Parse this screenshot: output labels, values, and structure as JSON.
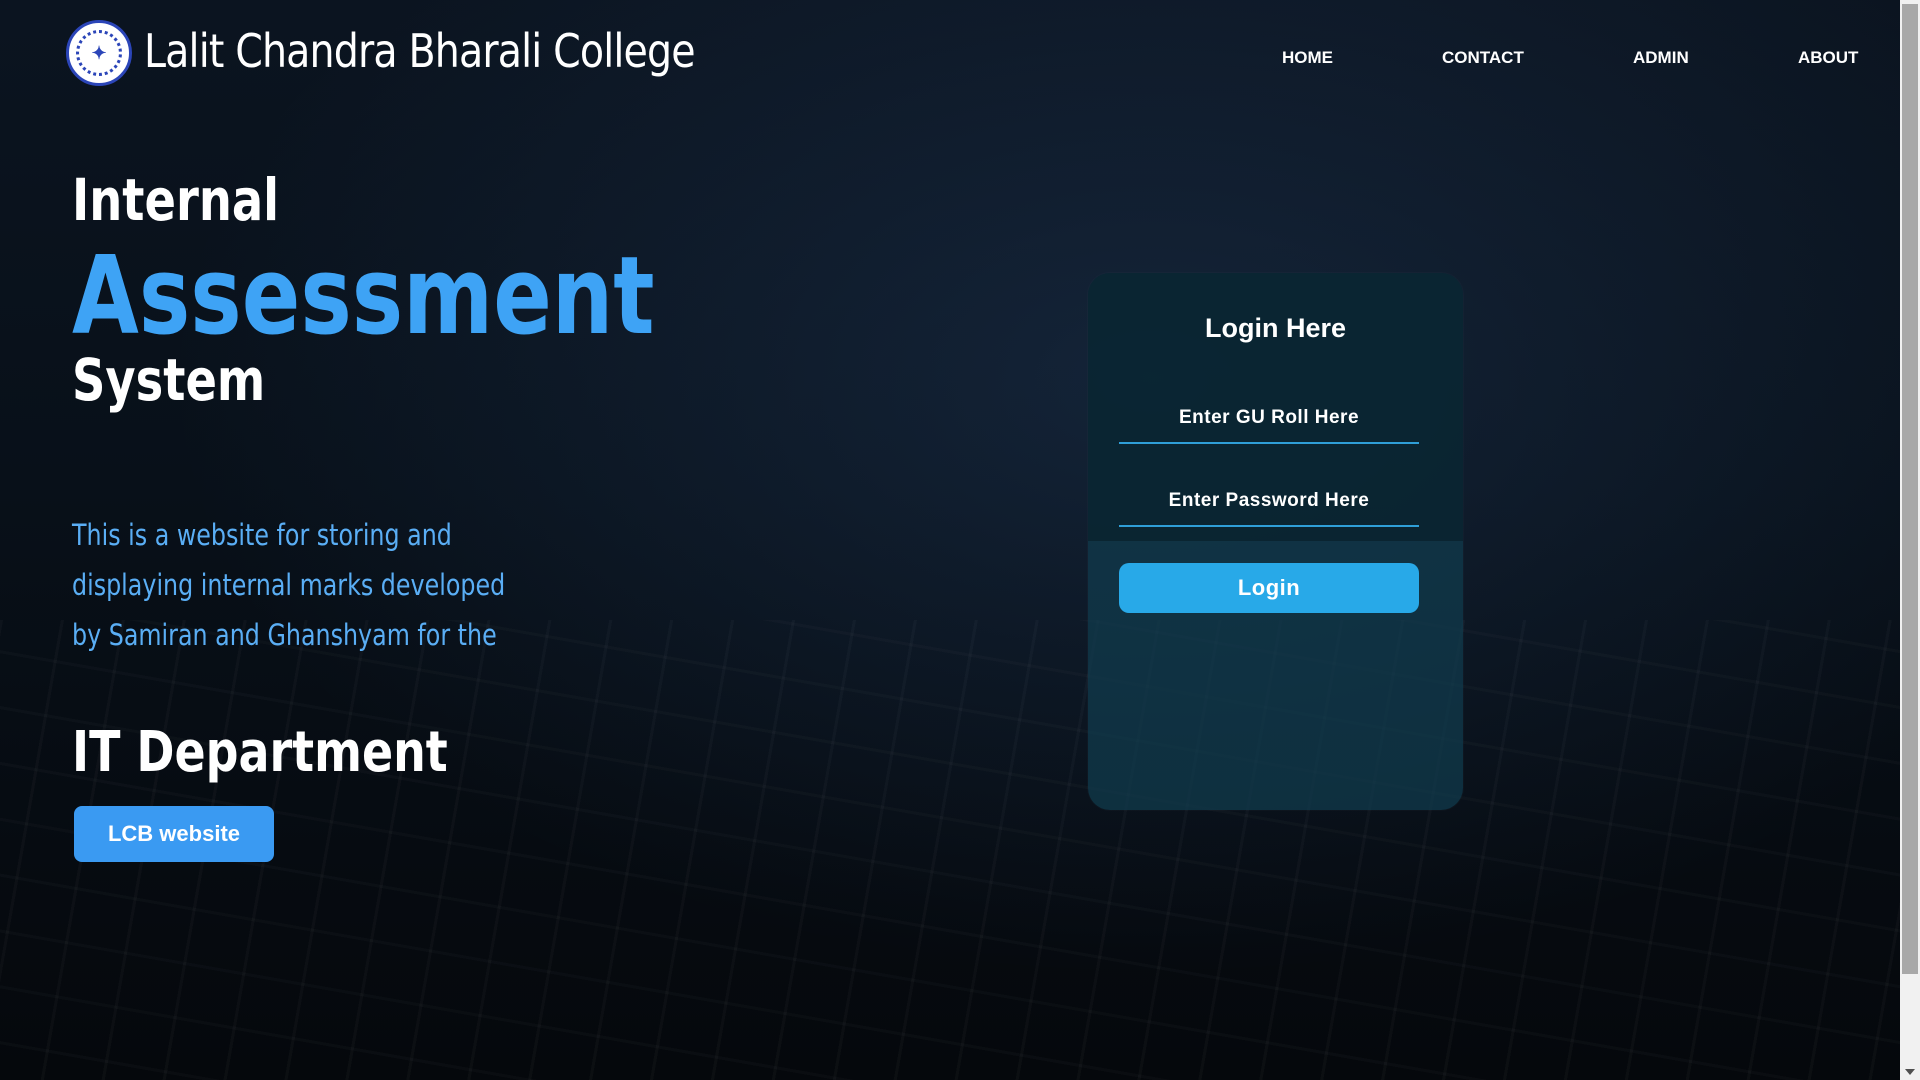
{
  "header": {
    "college_name": "Lalit Chandra Bharali College",
    "logo_icon": "college-seal-icon",
    "nav": {
      "home": "HOME",
      "contact": "CONTACT",
      "admin": "ADMIN",
      "about": "ABOUT"
    }
  },
  "hero": {
    "line1": "Internal",
    "line2": "Assessment",
    "line3": "System",
    "description": "This is a website for storing and displaying internal marks developed by Samiran and Ghanshyam for the",
    "department": "IT Department",
    "website_button": "LCB website"
  },
  "login": {
    "title": "Login Here",
    "roll_placeholder": "Enter GU Roll Here",
    "password_placeholder": "Enter Password Here",
    "button": "Login"
  },
  "colors": {
    "accent": "#3ea3f5",
    "login_button": "#28a9e8",
    "card": "#103c4e"
  }
}
